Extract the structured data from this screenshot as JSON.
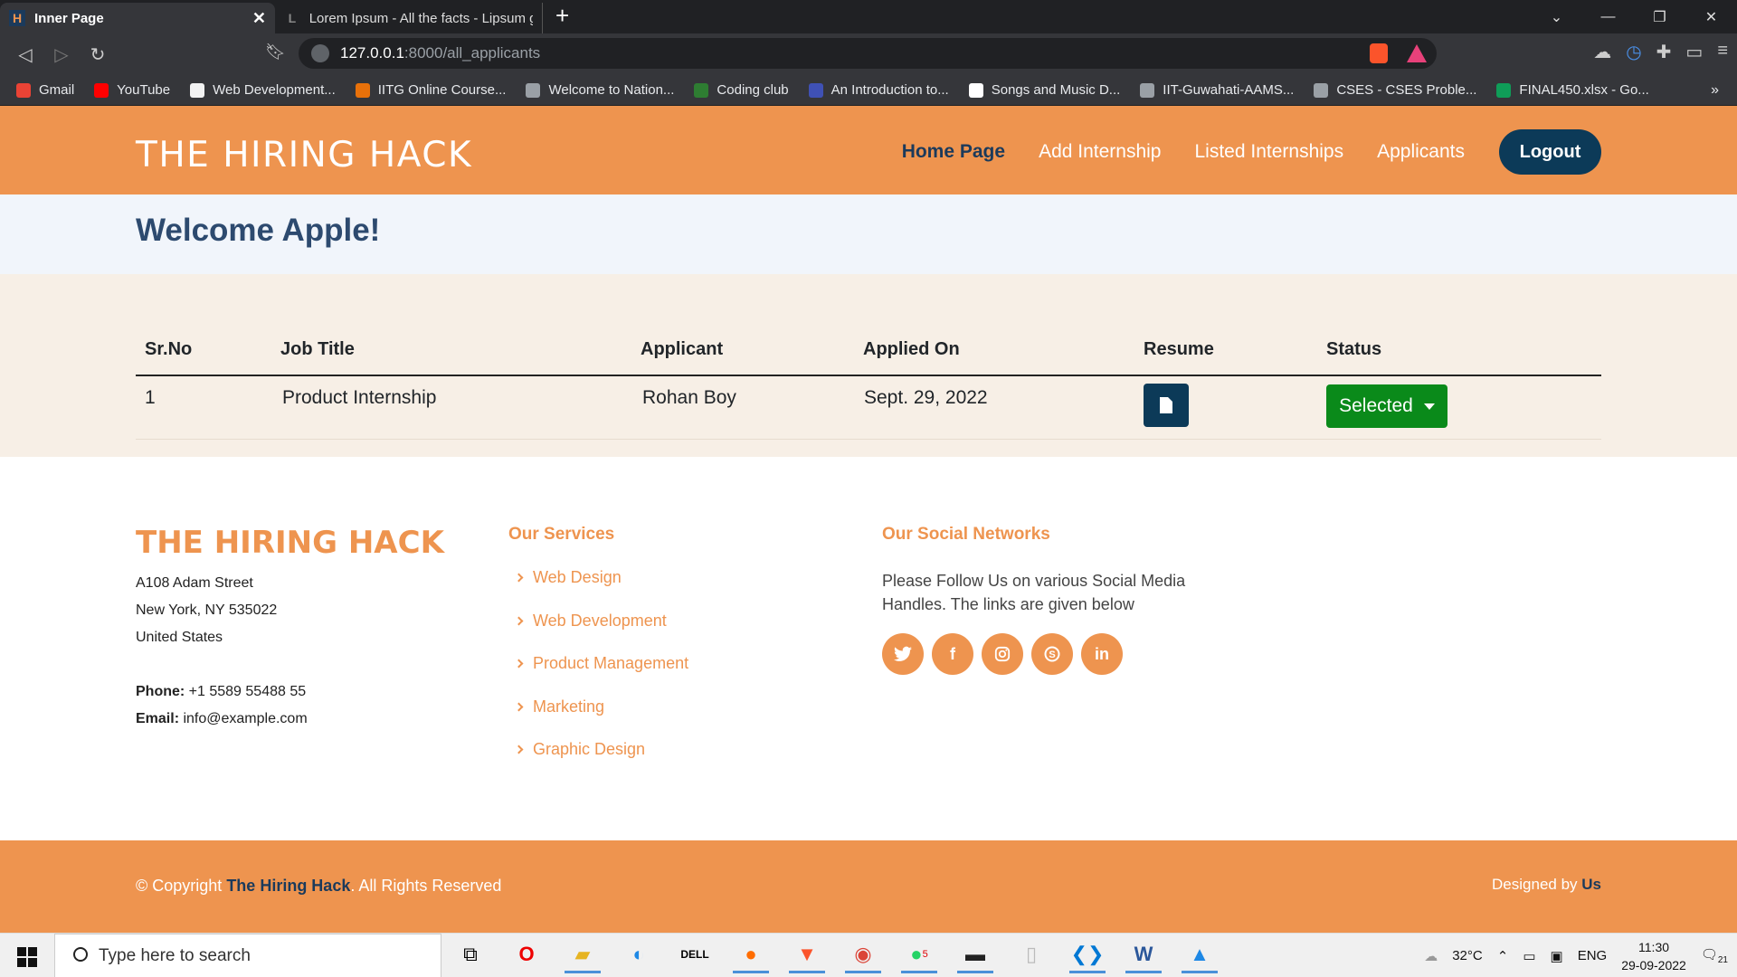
{
  "browser": {
    "tabs": [
      {
        "title": "Inner Page",
        "active": true,
        "favicon_icon": "hiring-hack-favicon"
      },
      {
        "title": "Lorem Ipsum - All the facts - Lipsum g",
        "active": false,
        "favicon_icon": "lipsum-favicon"
      }
    ],
    "address": {
      "host": "127.0.0.1",
      "path": ":8000/all_applicants"
    },
    "bookmarks": [
      {
        "label": "Gmail",
        "color": "#ea4335"
      },
      {
        "label": "YouTube",
        "color": "#ff0000"
      },
      {
        "label": "Web Development...",
        "color": "#f2f2f2"
      },
      {
        "label": "IITG Online Course...",
        "color": "#e8710a"
      },
      {
        "label": "Welcome to Nation...",
        "color": "#9aa0a6"
      },
      {
        "label": "Coding club",
        "color": "#2e7d32"
      },
      {
        "label": "An Introduction to...",
        "color": "#3f51b5"
      },
      {
        "label": "Songs and Music D...",
        "color": "#ffffff"
      },
      {
        "label": "IIT-Guwahati-AAMS...",
        "color": "#9aa0a6"
      },
      {
        "label": "CSES - CSES Proble...",
        "color": "#9aa0a6"
      },
      {
        "label": "FINAL450.xlsx - Go...",
        "color": "#0f9d58"
      }
    ],
    "bookmarks_more": "»"
  },
  "header": {
    "logo": "THE HIRING HACK",
    "nav": [
      "Home Page",
      "Add Internship",
      "Listed Internships",
      "Applicants"
    ],
    "logout": "Logout"
  },
  "welcome": "Welcome Apple!",
  "table": {
    "headers": [
      "Sr.No",
      "Job Title",
      "Applicant",
      "Applied On",
      "Resume",
      "Status"
    ],
    "rows": [
      {
        "sr": "1",
        "job": "Product Internship",
        "applicant": "Rohan Boy",
        "applied_on": "Sept. 29, 2022",
        "status": "Selected"
      }
    ]
  },
  "footer": {
    "logo": "THE HIRING HACK",
    "address": [
      "A108 Adam Street",
      "New York, NY 535022",
      "United States"
    ],
    "phone_label": "Phone:",
    "phone": "+1 5589 55488 55",
    "email_label": "Email:",
    "email": "info@example.com",
    "services_title": "Our Services",
    "services": [
      "Web Design",
      "Web Development",
      "Product Management",
      "Marketing",
      "Graphic Design"
    ],
    "social_title": "Our Social Networks",
    "social_text": "Please Follow Us on various Social Media Handles. The links are given below",
    "social_icons": [
      "twitter-icon",
      "facebook-icon",
      "instagram-icon",
      "skype-icon",
      "linkedin-icon"
    ],
    "copyright_prefix": "© Copyright ",
    "copyright_brand": "The Hiring Hack",
    "copyright_suffix": ". All Rights Reserved",
    "designed_prefix": "Designed by ",
    "designed_by": "Us"
  },
  "taskbar": {
    "search_placeholder": "Type here to search",
    "weather": "32°C",
    "lang": "ENG",
    "time": "11:30",
    "date": "29-09-2022",
    "notifications": "21",
    "whatsapp_badge": "5"
  },
  "colors": {
    "brand": "#ee944f",
    "navy": "#0c3a58",
    "status_selected": "#0a8a1a"
  }
}
